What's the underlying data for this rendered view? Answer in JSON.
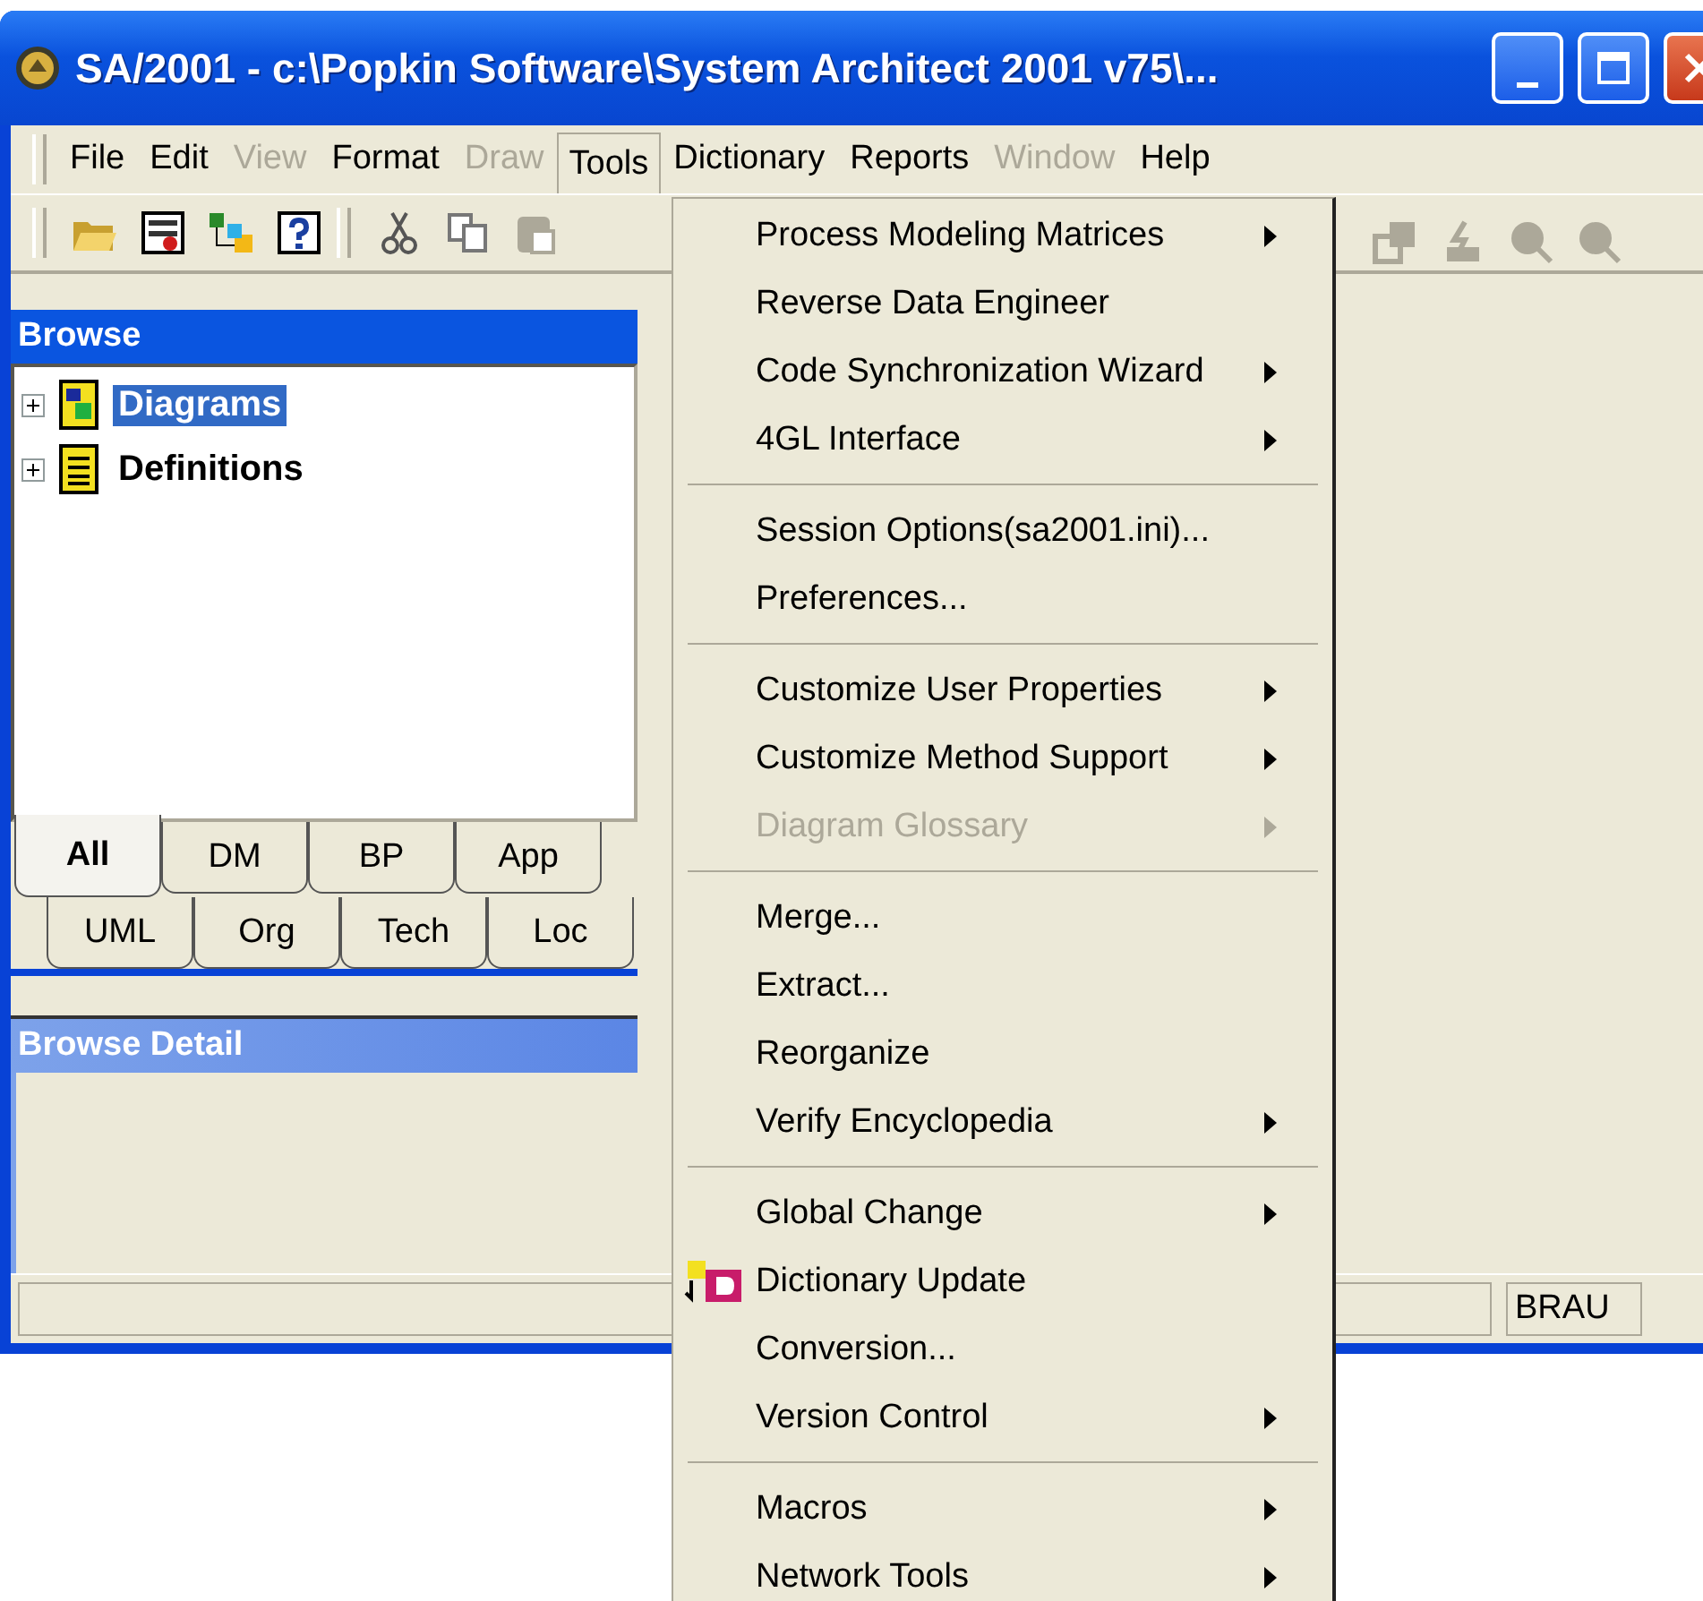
{
  "window": {
    "title": "SA/2001 - c:\\Popkin Software\\System Architect 2001 v75\\..."
  },
  "menu_bar": [
    {
      "label": "File",
      "disabled": false,
      "selected": false
    },
    {
      "label": "Edit",
      "disabled": false,
      "selected": false
    },
    {
      "label": "View",
      "disabled": true,
      "selected": false
    },
    {
      "label": "Format",
      "disabled": false,
      "selected": false
    },
    {
      "label": "Draw",
      "disabled": true,
      "selected": false
    },
    {
      "label": "Tools",
      "disabled": false,
      "selected": true
    },
    {
      "label": "Dictionary",
      "disabled": false,
      "selected": false
    },
    {
      "label": "Reports",
      "disabled": false,
      "selected": false
    },
    {
      "label": "Window",
      "disabled": true,
      "selected": false
    },
    {
      "label": "Help",
      "disabled": false,
      "selected": false
    }
  ],
  "toolbar": {
    "edit": [
      {
        "disabled": false
      },
      {
        "disabled": false
      },
      {
        "disabled": true
      }
    ],
    "right": [
      {
        "disabled": true
      },
      {
        "disabled": true
      },
      {
        "disabled": true
      },
      {
        "disabled": true
      }
    ]
  },
  "browse": {
    "title": "Browse",
    "tree": [
      {
        "label": "Diagrams",
        "expanded": false,
        "selected": true
      },
      {
        "label": "Definitions",
        "expanded": false,
        "selected": false
      }
    ],
    "tab_rows": [
      [
        {
          "label": "All",
          "selected": true
        },
        {
          "label": "DM",
          "selected": false
        },
        {
          "label": "BP",
          "selected": false
        },
        {
          "label": "App",
          "selected": false
        }
      ],
      [
        {
          "label": "UML",
          "selected": false
        },
        {
          "label": "Org",
          "selected": false
        },
        {
          "label": "Tech",
          "selected": false
        },
        {
          "label": "Loc",
          "selected": false
        }
      ]
    ]
  },
  "browse_detail": {
    "title": "Browse Detail"
  },
  "status_bar": {
    "field_2": "BRAU"
  },
  "tools_menu": [
    {
      "kind": "item",
      "label": "Process Modeling Matrices",
      "submenu": true,
      "disabled": false
    },
    {
      "kind": "item",
      "label": "Reverse Data Engineer",
      "submenu": false,
      "disabled": false
    },
    {
      "kind": "item",
      "label": "Code Synchronization Wizard",
      "submenu": true,
      "disabled": false
    },
    {
      "kind": "item",
      "label": "4GL Interface",
      "submenu": true,
      "disabled": false
    },
    {
      "kind": "separator"
    },
    {
      "kind": "item",
      "label": "Session Options(sa2001.ini)...",
      "submenu": false,
      "disabled": false
    },
    {
      "kind": "item",
      "label": "Preferences...",
      "submenu": false,
      "disabled": false
    },
    {
      "kind": "separator"
    },
    {
      "kind": "item",
      "label": "Customize User Properties",
      "submenu": true,
      "disabled": false
    },
    {
      "kind": "item",
      "label": "Customize Method Support",
      "submenu": true,
      "disabled": false
    },
    {
      "kind": "item",
      "label": "Diagram Glossary",
      "submenu": true,
      "disabled": true
    },
    {
      "kind": "separator"
    },
    {
      "kind": "item",
      "label": "Merge...",
      "submenu": false,
      "disabled": false
    },
    {
      "kind": "item",
      "label": "Extract...",
      "submenu": false,
      "disabled": false
    },
    {
      "kind": "item",
      "label": "Reorganize",
      "submenu": false,
      "disabled": false
    },
    {
      "kind": "item",
      "label": "Verify Encyclopedia",
      "submenu": true,
      "disabled": false
    },
    {
      "kind": "separator"
    },
    {
      "kind": "item",
      "label": "Global Change",
      "submenu": true,
      "disabled": false
    },
    {
      "kind": "icon_item",
      "label": "Dictionary Update",
      "submenu": false,
      "disabled": false
    },
    {
      "kind": "item",
      "label": "Conversion...",
      "submenu": false,
      "disabled": false
    },
    {
      "kind": "item",
      "label": "Version Control",
      "submenu": true,
      "disabled": false
    },
    {
      "kind": "separator"
    },
    {
      "kind": "item",
      "label": "Macros",
      "submenu": true,
      "disabled": false
    },
    {
      "kind": "item",
      "label": "Network Tools",
      "submenu": true,
      "disabled": false
    }
  ]
}
